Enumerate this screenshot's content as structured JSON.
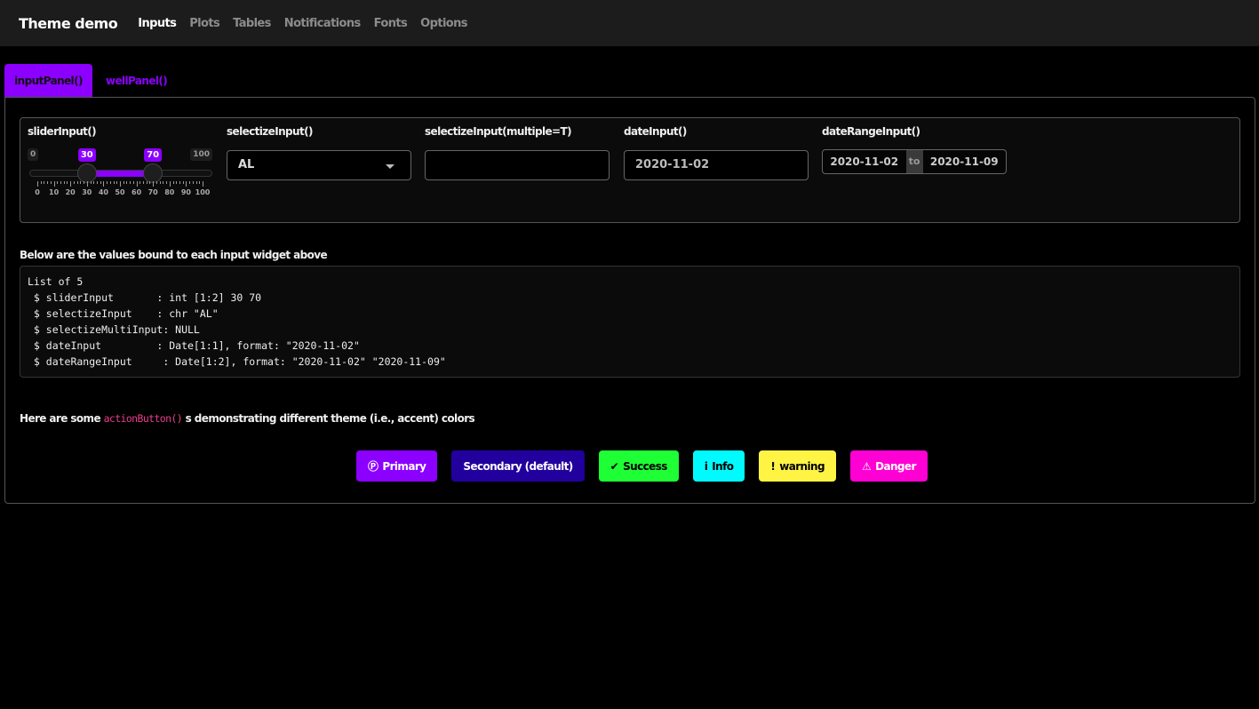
{
  "navbar": {
    "brand": "Theme demo",
    "items": [
      {
        "label": "Inputs",
        "active": true
      },
      {
        "label": "Plots",
        "active": false
      },
      {
        "label": "Tables",
        "active": false
      },
      {
        "label": "Notifications",
        "active": false
      },
      {
        "label": "Fonts",
        "active": false
      },
      {
        "label": "Options",
        "active": false
      }
    ]
  },
  "tabs": [
    {
      "label": "inputPanel()",
      "active": true
    },
    {
      "label": "wellPanel()",
      "active": false
    }
  ],
  "inputs": {
    "slider": {
      "label": "sliderInput()",
      "min": 0,
      "max": 100,
      "min_label": "0",
      "max_label": "100",
      "value_low": 30,
      "value_high": 70,
      "value_low_label": "30",
      "value_high_label": "70",
      "tick_labels": [
        "0",
        "10",
        "20",
        "30",
        "40",
        "50",
        "60",
        "70",
        "80",
        "90",
        "100"
      ]
    },
    "selectize": {
      "label": "selectizeInput()",
      "value": "AL"
    },
    "selectize_multi": {
      "label": "selectizeInput(multiple=T)",
      "value": ""
    },
    "date": {
      "label": "dateInput()",
      "value": "2020-11-02"
    },
    "date_range": {
      "label": "dateRangeInput()",
      "start": "2020-11-02",
      "separator": "to",
      "end": "2020-11-09"
    }
  },
  "values_heading": "Below are the values bound to each input widget above",
  "values_output": "List of 5\n $ sliderInput       : int [1:2] 30 70\n $ selectizeInput    : chr \"AL\"\n $ selectizeMultiInput: NULL\n $ dateInput         : Date[1:1], format: \"2020-11-02\"\n $ dateRangeInput     : Date[1:2], format: \"2020-11-02\" \"2020-11-09\"",
  "buttons_intro": {
    "before": "Here are some ",
    "code": "actionButton()",
    "after": " s demonstrating different theme (i.e., accent) colors"
  },
  "buttons": [
    {
      "label": "Primary",
      "icon": "product-hunt-icon",
      "glyph": "Ⓟ",
      "bg": "#8b00ff",
      "fg": "#ffffff"
    },
    {
      "label": "Secondary (default)",
      "icon": "",
      "glyph": "",
      "bg": "#22009d",
      "fg": "#ffffff"
    },
    {
      "label": "Success",
      "icon": "check-icon",
      "glyph": "✔",
      "bg": "#1eff36",
      "fg": "#000000"
    },
    {
      "label": "Info",
      "icon": "info-icon",
      "glyph": "i",
      "bg": "#00fbff",
      "fg": "#000000"
    },
    {
      "label": "warning",
      "icon": "exclamation-icon",
      "glyph": "!",
      "bg": "#fff444",
      "fg": "#000000"
    },
    {
      "label": "Danger",
      "icon": "warning-triangle-icon",
      "glyph": "⚠",
      "bg": "#ff00d4",
      "fg": "#ffffff"
    }
  ]
}
